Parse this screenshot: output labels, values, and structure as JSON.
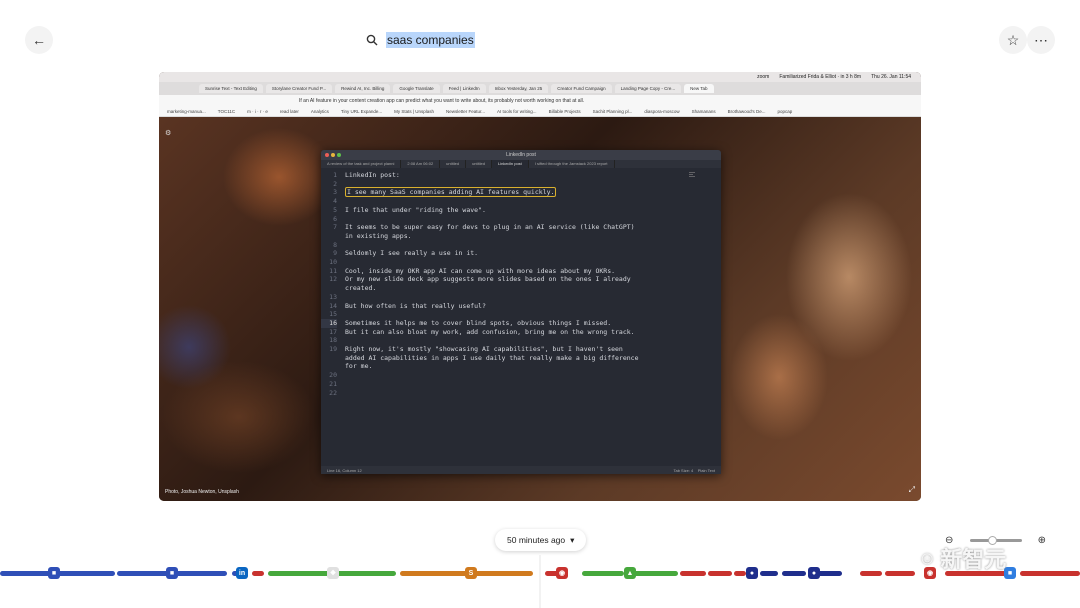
{
  "search": {
    "query": "saas companies"
  },
  "top_icons": {
    "back": "arrow-left-icon",
    "star": "star-icon",
    "more": "ellipsis-icon"
  },
  "screenshot": {
    "menubar": {
      "app": "zoom",
      "event": "Familiarized Frida & Elliot · in 3 h 8m",
      "clock": "Thu 26. Jan 11:54"
    },
    "browser_tabs": [
      "Sunrise Text - Text Editing",
      "Storylane Creator Fund P...",
      "Rewind AI, Inc. Billing",
      "Google Translate",
      "Feed | LinkedIn",
      "Inbox Yesterday, Jan 25",
      "Creator Fund Campaign",
      "Landing Page Copy - Cre...",
      "New Tab"
    ],
    "url": "If an AI feature in your content creation app can predict what you want to write about, its probably not worth working on that at all.",
    "bookmarks": [
      "marketing-manua...",
      "TOC11C",
      "m · i · r · e",
      "read later",
      "Analytics",
      "Tiny URL Expande...",
      "My Stats | Unsplash",
      "Newsletter Featur...",
      "AI tools for writing...",
      "Billable Projects",
      "Sachit Planning pl...",
      "diaspora-moscow",
      "Shamanans",
      "Brothawood's De...",
      "popcap"
    ],
    "photo_credit": "Photo, Joshua Newton, Unsplash",
    "editor": {
      "title": "LinkedIn post",
      "tabs": [
        "A review of the task and project planni",
        "2:08 Am 06:02",
        "untitled",
        "untitled",
        "LinkedIn post",
        "I sifted through the Jamstack 2023 report"
      ],
      "current_line": 16,
      "lines": [
        "LinkedIn post:",
        "",
        "I see many SaaS companies adding AI features quickly.",
        "",
        "I file that under \"riding the wave\".",
        "",
        "It seems to be super easy for devs to plug in an AI service (like ChatGPT)",
        "in existing apps.",
        "",
        "Seldomly I see really a use in it.",
        "",
        "Cool, inside my OKR app AI can come up with more ideas about my OKRs.",
        "Or my new slide deck app suggests more slides based on the ones I already",
        "created.",
        "",
        "But how often is that really useful?",
        "",
        "Sometimes it helps me to cover blind spots, obvious things I missed.",
        "But it can also bloat my work, add confusion, bring me on the wrong track.",
        "",
        "Right now, it's mostly \"showcasing AI capabilities\", but I haven't seen",
        "added AI capabilities in apps I use daily that really make a big difference",
        "for me.",
        "",
        "",
        ""
      ],
      "line_numbers": [
        "1",
        "2",
        "3",
        "4",
        "5",
        "6",
        "7",
        "",
        "8",
        "9",
        "10",
        "11",
        "12",
        "",
        "13",
        "14",
        "15",
        "16",
        "17",
        "18",
        "19",
        "",
        "",
        "20",
        "21",
        "22"
      ],
      "status_left": "Line 16, Column 12",
      "status_tab": "Tab Size: 4",
      "status_syntax": "Plain Text"
    }
  },
  "timeline": {
    "time_label": "50 minutes ago",
    "colors": {
      "blue": "#2f4fb7",
      "red": "#c8322e",
      "green": "#46a83c",
      "orange": "#d07a1e",
      "dark_blue": "#1f2e8c"
    }
  },
  "watermark": {
    "text": "新智元"
  }
}
